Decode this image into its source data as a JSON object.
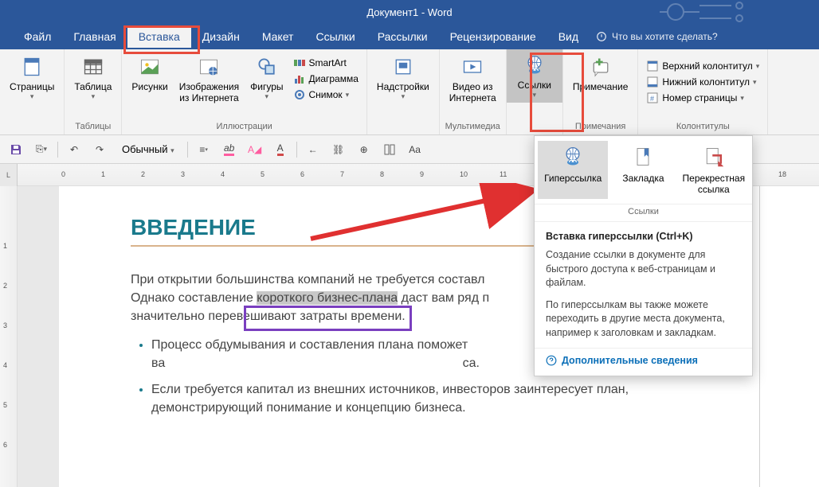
{
  "title": "Документ1 - Word",
  "menu": {
    "file": "Файл",
    "home": "Главная",
    "insert": "Вставка",
    "design": "Дизайн",
    "layout": "Макет",
    "references": "Ссылки",
    "mailings": "Рассылки",
    "review": "Рецензирование",
    "view": "Вид",
    "tellme": "Что вы хотите сделать?"
  },
  "ribbon": {
    "pages": {
      "label": "Страницы",
      "btn": "Страницы"
    },
    "tables": {
      "label": "Таблицы",
      "btn": "Таблица"
    },
    "illustrations": {
      "label": "Иллюстрации",
      "pictures": "Рисунки",
      "online": "Изображения\nиз Интернета",
      "shapes": "Фигуры",
      "smartart": "SmartArt",
      "chart": "Диаграмма",
      "screenshot": "Снимок"
    },
    "addins": {
      "label": "",
      "btn": "Надстройки"
    },
    "media": {
      "label": "Мультимедиа",
      "btn": "Видео из\nИнтернета"
    },
    "links": {
      "label": "",
      "btn": "Ссылки"
    },
    "comments": {
      "label": "Примечания",
      "btn": "Примечание"
    },
    "headerfooter": {
      "label": "Колонтитулы",
      "header": "Верхний колонтитул",
      "footer": "Нижний колонтитул",
      "pagenum": "Номер страницы"
    }
  },
  "quick": {
    "style": "Обычный"
  },
  "dropdown": {
    "hyperlink": "Гиперссылка",
    "bookmark": "Закладка",
    "crossref": "Перекрестная\nссылка",
    "group": "Ссылки",
    "tip_title": "Вставка гиперссылки (Ctrl+K)",
    "tip_p1": "Создание ссылки в документе для быстрого доступа к веб-страницам и файлам.",
    "tip_p2": "По гиперссылкам вы также можете переходить в другие места документа, например к заголовкам и закладкам.",
    "more": "Дополнительные сведения"
  },
  "doc": {
    "heading": "ВВЕДЕНИЕ",
    "p1a": "При открытии большинства компаний не требуется составл",
    "p1b": "Однако составление ",
    "p1sel": "короткого бизнес-плана",
    "p1c": " даст вам ряд п",
    "p1d": "значительно перевешивают затраты времени.",
    "b1": "Процесс обдумывания и составления плана поможет ва                                                                                    са.",
    "b2": "Если требуется капитал из внешних источников, инвесторов заинтересует план, демонстрирующий понимание и концепцию бизнеса."
  }
}
